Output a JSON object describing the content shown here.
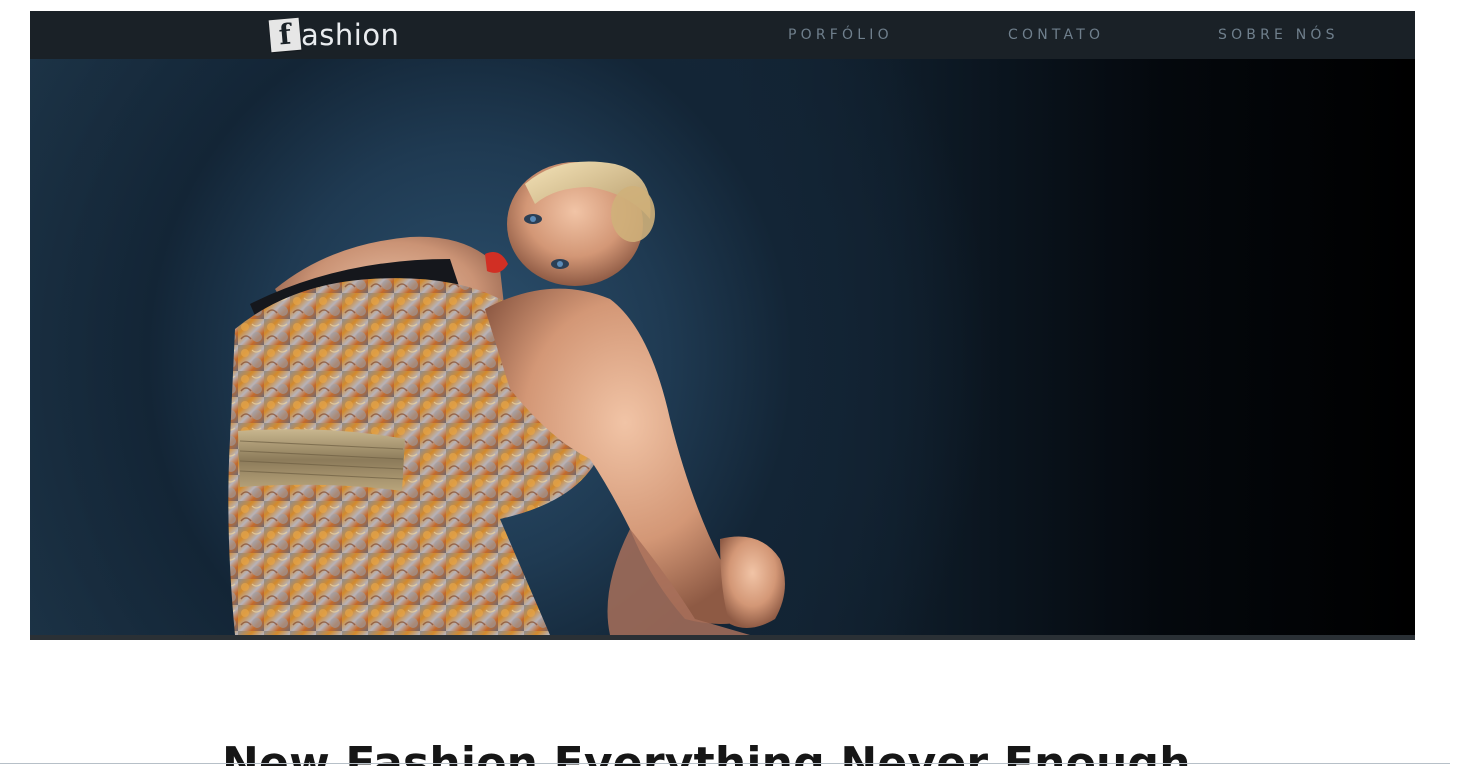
{
  "header": {
    "logo_letter": "f",
    "logo_text": "ashion",
    "nav": [
      {
        "label": "PORFÓLIO"
      },
      {
        "label": "CONTATO"
      },
      {
        "label": "SOBRE NÓS"
      }
    ]
  },
  "hero": {
    "image": "fashion-model-photo"
  },
  "main": {
    "headline": "New Fashion Everything Never Enough"
  },
  "colors": {
    "navbar_bg": "#1a2127",
    "nav_text": "#6f7f8c",
    "logo_text": "#e9ecef",
    "headline": "#161616"
  }
}
